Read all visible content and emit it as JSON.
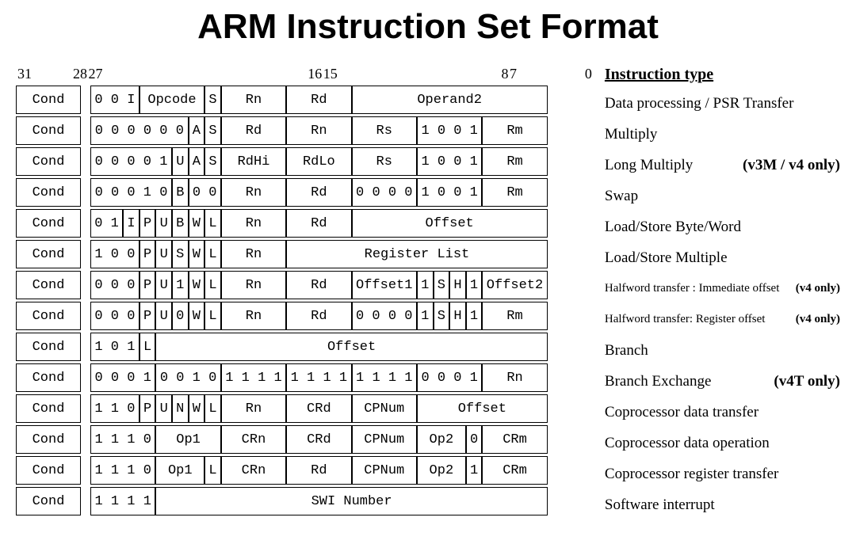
{
  "title": "ARM Instruction Set Format",
  "bit_header": {
    "b31": "31",
    "b2827": "28 27",
    "b1615": "16 15",
    "b87": "8 7",
    "b0": "0"
  },
  "side_header": "Instruction type",
  "rows": [
    {
      "cells": [
        "Cond",
        "0 0 I",
        "Opcode",
        "S",
        "Rn",
        "Rd",
        "Operand2"
      ],
      "widths": [
        "c4",
        "b3",
        "b4",
        "b1",
        "b4",
        "b4",
        "b12"
      ],
      "label": "Data processing / PSR Transfer",
      "note": ""
    },
    {
      "cells": [
        "Cond",
        "0 0 0 0 0 0",
        "A",
        "S",
        "Rd",
        "Rn",
        "Rs",
        "1 0 0 1",
        "Rm"
      ],
      "widths": [
        "c4",
        "b6",
        "b1",
        "b1",
        "b4",
        "b4",
        "b4",
        "b4",
        "b4"
      ],
      "label": "Multiply",
      "note": ""
    },
    {
      "cells": [
        "Cond",
        "0 0 0 0 1",
        "U",
        "A",
        "S",
        "RdHi",
        "RdLo",
        "Rs",
        "1 0 0 1",
        "Rm"
      ],
      "widths": [
        "c4",
        "b5",
        "b1",
        "b1",
        "b1",
        "b4",
        "b4",
        "b4",
        "b4",
        "b4"
      ],
      "label": "Long Multiply",
      "note": "(v3M / v4 only)"
    },
    {
      "cells": [
        "Cond",
        "0 0 0 1 0",
        "B",
        "0 0",
        "Rn",
        "Rd",
        "0 0 0 0",
        "1 0 0 1",
        "Rm"
      ],
      "widths": [
        "c4",
        "b5",
        "b1",
        "b2",
        "b4",
        "b4",
        "b4",
        "b4",
        "b4"
      ],
      "label": "Swap",
      "note": ""
    },
    {
      "cells": [
        "Cond",
        "0 1",
        "I",
        "P",
        "U",
        "B",
        "W",
        "L",
        "Rn",
        "Rd",
        "Offset"
      ],
      "widths": [
        "c4",
        "b2",
        "b1",
        "b1",
        "b1",
        "b1",
        "b1",
        "b1",
        "b4",
        "b4",
        "b12"
      ],
      "label": "Load/Store Byte/Word",
      "note": ""
    },
    {
      "cells": [
        "Cond",
        "1 0 0",
        "P",
        "U",
        "S",
        "W",
        "L",
        "Rn",
        "Register List"
      ],
      "widths": [
        "c4",
        "b3",
        "b1",
        "b1",
        "b1",
        "b1",
        "b1",
        "b4",
        "b16"
      ],
      "label": "Load/Store Multiple",
      "note": ""
    },
    {
      "cells": [
        "Cond",
        "0 0 0",
        "P",
        "U",
        "1",
        "W",
        "L",
        "Rn",
        "Rd",
        "Offset1",
        "1",
        "S",
        "H",
        "1",
        "Offset2"
      ],
      "widths": [
        "c4",
        "b3",
        "b1",
        "b1",
        "b1",
        "b1",
        "b1",
        "b4",
        "b4",
        "b4",
        "b1",
        "b1",
        "b1",
        "b1",
        "b4"
      ],
      "label": "Halfword transfer : Immediate offset",
      "note": "(v4 only)",
      "small": true
    },
    {
      "cells": [
        "Cond",
        "0 0 0",
        "P",
        "U",
        "0",
        "W",
        "L",
        "Rn",
        "Rd",
        "0 0 0 0",
        "1",
        "S",
        "H",
        "1",
        "Rm"
      ],
      "widths": [
        "c4",
        "b3",
        "b1",
        "b1",
        "b1",
        "b1",
        "b1",
        "b4",
        "b4",
        "b4",
        "b1",
        "b1",
        "b1",
        "b1",
        "b4"
      ],
      "label": "Halfword  transfer: Register offset",
      "note": "(v4 only)",
      "small": true
    },
    {
      "cells": [
        "Cond",
        "1 0 1",
        "L",
        "Offset"
      ],
      "widths": [
        "c4",
        "b3",
        "b1",
        "b24"
      ],
      "label": "Branch",
      "note": ""
    },
    {
      "cells": [
        "Cond",
        "0 0 0 1",
        "0 0 1 0",
        "1 1 1 1",
        "1 1 1 1",
        "1 1 1 1",
        "0 0 0 1",
        "Rn"
      ],
      "widths": [
        "c4",
        "b4",
        "b4",
        "b4",
        "b4",
        "b4",
        "b4",
        "b4"
      ],
      "label": "Branch Exchange",
      "note": "(v4T only)"
    },
    {
      "cells": [
        "Cond",
        "1 1 0",
        "P",
        "U",
        "N",
        "W",
        "L",
        "Rn",
        "CRd",
        "CPNum",
        "Offset"
      ],
      "widths": [
        "c4",
        "b3",
        "b1",
        "b1",
        "b1",
        "b1",
        "b1",
        "b4",
        "b4",
        "b4",
        "b8"
      ],
      "label": "Coprocessor data transfer",
      "note": ""
    },
    {
      "cells": [
        "Cond",
        "1 1 1 0",
        "Op1",
        "CRn",
        "CRd",
        "CPNum",
        "Op2",
        "0",
        "CRm"
      ],
      "widths": [
        "c4",
        "b4",
        "b4",
        "b4",
        "b4",
        "b4",
        "b3",
        "b1",
        "b4"
      ],
      "label": "Coprocessor data operation",
      "note": ""
    },
    {
      "cells": [
        "Cond",
        "1 1 1 0",
        "Op1",
        "L",
        "CRn",
        "Rd",
        "CPNum",
        "Op2",
        "1",
        "CRm"
      ],
      "widths": [
        "c4",
        "b4",
        "b3",
        "b1",
        "b4",
        "b4",
        "b4",
        "b3",
        "b1",
        "b4"
      ],
      "label": "Coprocessor register transfer",
      "note": ""
    },
    {
      "cells": [
        "Cond",
        "1 1 1 1",
        "SWI Number"
      ],
      "widths": [
        "c4",
        "b4",
        "b24"
      ],
      "label": "Software interrupt",
      "note": ""
    }
  ]
}
